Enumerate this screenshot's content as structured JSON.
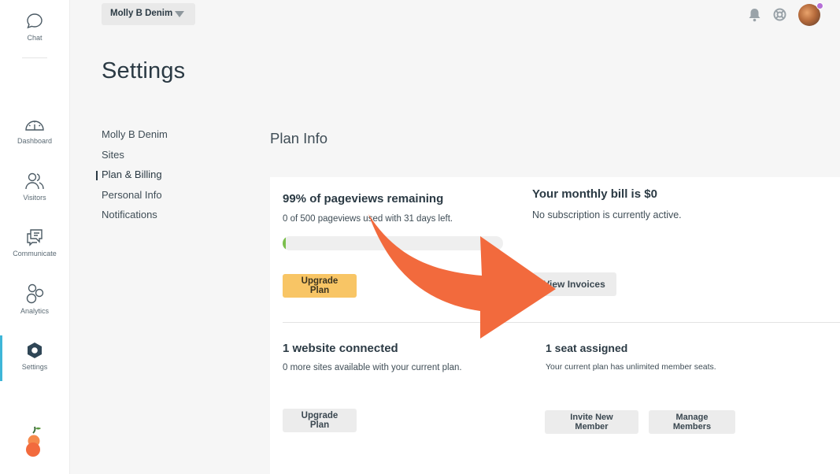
{
  "rail": {
    "items": [
      {
        "label": "Chat",
        "icon": "chat-bubble-icon"
      },
      {
        "label": "Dashboard",
        "icon": "gauge-icon"
      },
      {
        "label": "Visitors",
        "icon": "users-icon"
      },
      {
        "label": "Communicate",
        "icon": "messages-icon"
      },
      {
        "label": "Analytics",
        "icon": "analytics-circles-icon"
      },
      {
        "label": "Settings",
        "icon": "hexagon-settings-icon"
      }
    ],
    "active": "Settings",
    "active_color": "#3fb6d8",
    "logo_icon": "orange-fruit-logo",
    "logo_color": "#f26a3d"
  },
  "topbar": {
    "account": "Molly B Denim",
    "icons": [
      "bell-icon",
      "help-lifebuoy-icon",
      "user-avatar"
    ]
  },
  "page": {
    "title": "Settings"
  },
  "settings_nav": {
    "items": [
      "Molly B Denim",
      "Sites",
      "Plan & Billing",
      "Personal Info",
      "Notifications"
    ],
    "active": "Plan & Billing"
  },
  "plan": {
    "section_title": "Plan Info",
    "pageviews": {
      "heading": "99% of pageviews remaining",
      "detail": "0 of 500 pageviews used with 31 days left.",
      "used_fraction": 0.01,
      "bar_color": "#7bbf4d",
      "button": "Upgrade Plan",
      "button_color": "#f8c565"
    },
    "bill": {
      "heading": "Your monthly bill is $0",
      "detail": "No subscription is currently active.",
      "button": "View Invoices"
    },
    "websites": {
      "heading": "1 website connected",
      "detail": "0 more sites available with your current plan.",
      "button": "Upgrade Plan"
    },
    "seats": {
      "heading": "1 seat assigned",
      "detail": "Your current plan has unlimited member seats.",
      "invite_button": "Invite New Member",
      "manage_button": "Manage Members"
    }
  },
  "annotation": {
    "arrow_color": "#f26a3d",
    "points_to": "View Invoices"
  }
}
